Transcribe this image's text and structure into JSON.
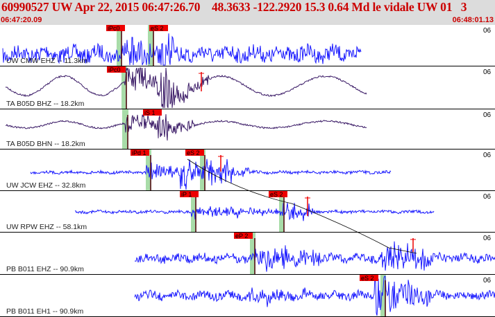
{
  "header": {
    "title": "60990527 UW Apr 22, 2015 06:47:26.70    48.3633 -122.2920 15.3 0.64 Md le vidale UW 01   3",
    "start_time": "06:47:20.09",
    "end_time": "06:48:01.13"
  },
  "colors": {
    "header_bg": "#dcdcdc",
    "title_text": "#cc0000",
    "trace_blue": "#1a1aff",
    "trace_purple": "#3a1a66",
    "pick_box": "#ee0000",
    "pick_band": "#a8dca8"
  },
  "time_axis_tick": "06",
  "panels": [
    {
      "label": "UW CMW EHZ -- 11.3km",
      "picks": [
        "iPc0",
        "eS 2"
      ]
    },
    {
      "label": "TA B05D BHZ -- 18.2km",
      "picks": [
        "iPc0"
      ]
    },
    {
      "label": "TA B05D BHN -- 18.2km",
      "picks": [
        "iS 1"
      ]
    },
    {
      "label": "UW JCW EHZ -- 32.8km",
      "picks": [
        "iPd 1",
        "eS 2"
      ]
    },
    {
      "label": "UW RPW EHZ -- 58.1km",
      "picks": [
        "iP 1",
        "eS 2"
      ]
    },
    {
      "label": "PB B011 EHZ -- 90.9km",
      "picks": [
        "eP 2"
      ]
    },
    {
      "label": "PB B011 EH1 -- 90.9km",
      "picks": [
        "eS 2"
      ]
    }
  ]
}
